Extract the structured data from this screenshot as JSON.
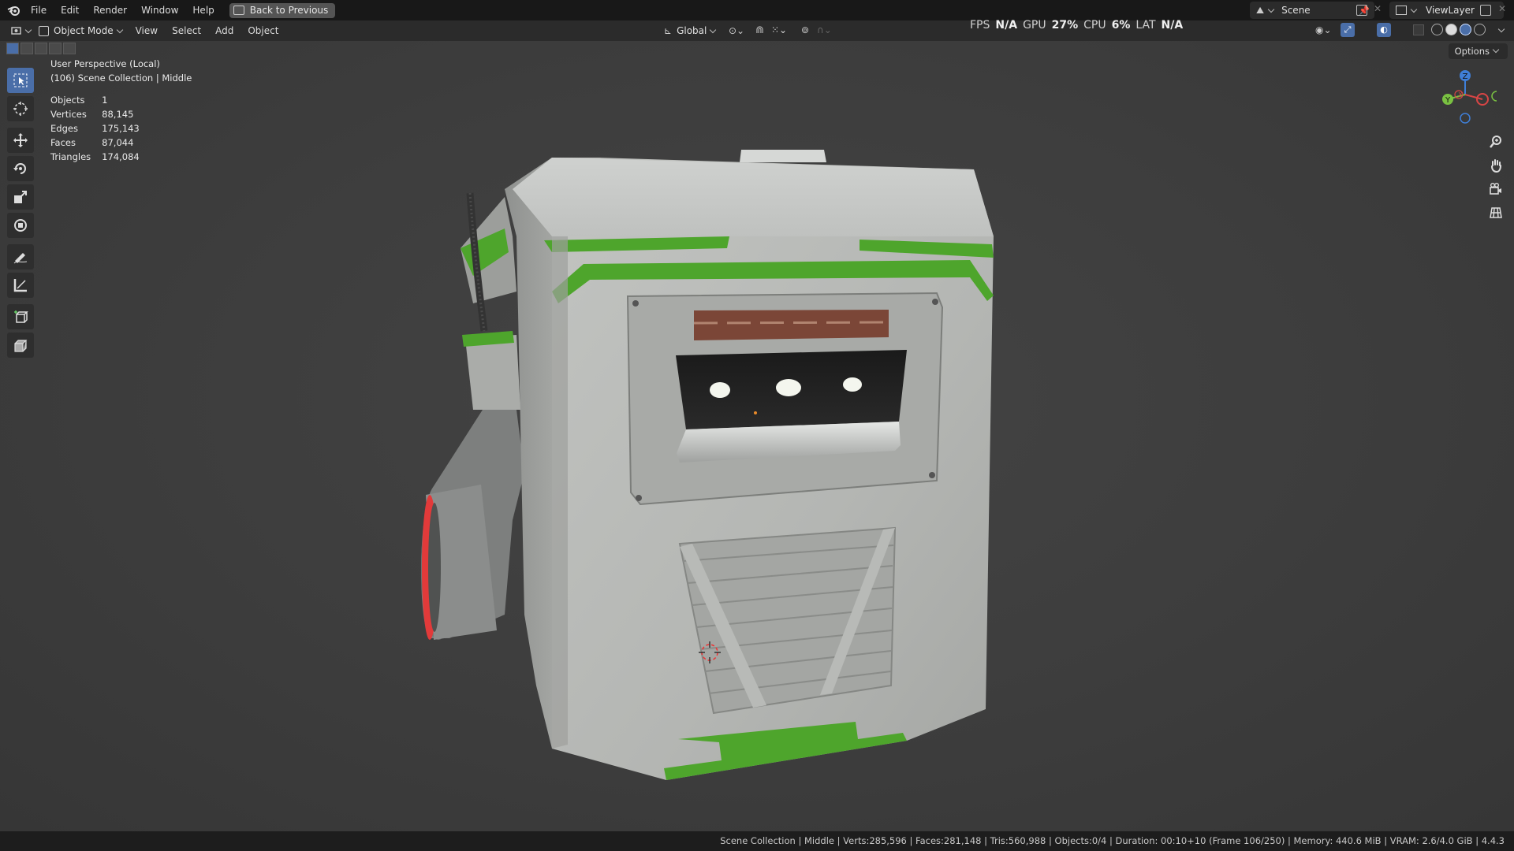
{
  "menu": {
    "file": "File",
    "edit": "Edit",
    "render": "Render",
    "window": "Window",
    "help": "Help",
    "back_to_previous": "Back to Previous"
  },
  "workspace": {
    "scene_name": "Scene",
    "view_layer": "ViewLayer"
  },
  "header": {
    "mode": "Object Mode",
    "view": "View",
    "select": "Select",
    "add": "Add",
    "object": "Object",
    "orientation": "Global",
    "options": "Options"
  },
  "perf": {
    "fps_label": "FPS",
    "fps_value": "N/A",
    "gpu_label": "GPU",
    "gpu_value": "27%",
    "cpu_label": "CPU",
    "cpu_value": "6%",
    "lat_label": "LAT",
    "lat_value": "N/A"
  },
  "viewport_info": {
    "perspective": "User Perspective (Local)",
    "collection": "(106) Scene Collection | Middle",
    "stats": [
      {
        "label": "Objects",
        "value": "1"
      },
      {
        "label": "Vertices",
        "value": "88,145"
      },
      {
        "label": "Edges",
        "value": "175,143"
      },
      {
        "label": "Faces",
        "value": "87,044"
      },
      {
        "label": "Triangles",
        "value": "174,084"
      }
    ]
  },
  "gizmo": {
    "x": "X",
    "y": "Y",
    "z": "Z"
  },
  "status": {
    "text": "Scene Collection | Middle | Verts:285,596 | Faces:281,148 | Tris:560,988 | Objects:0/4 | Duration: 00:10+10 (Frame 106/250) | Memory: 440.6 MiB | VRAM: 2.6/4.0 GiB | 4.4.3"
  },
  "colors": {
    "accent": "#4a6ea8",
    "model_body": "#b4b6b2",
    "model_stripe": "#4ea52c",
    "model_red": "#e23a3a"
  }
}
